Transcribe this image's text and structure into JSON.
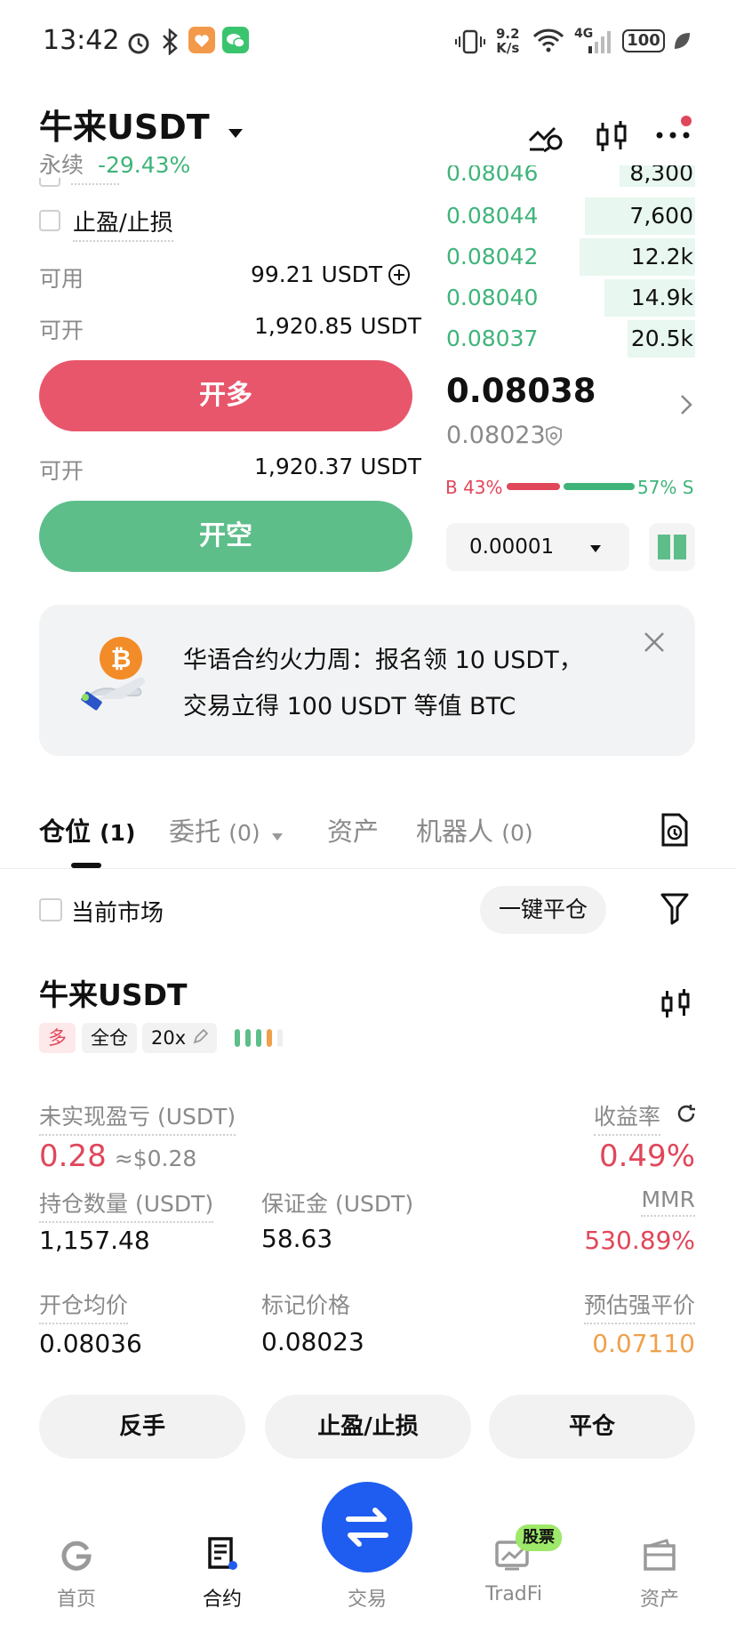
{
  "status_bar": {
    "time": "13:42",
    "net_speed_top": "9.2",
    "net_speed_bottom": "K/s",
    "network": "4G",
    "battery": "100"
  },
  "header": {
    "pair": "牛来USDT",
    "type": "永续",
    "change": "-29.43%"
  },
  "order_form": {
    "tpsl_label": "止盈/止损",
    "available_label": "可用",
    "available_value": "99.21 USDT",
    "long_open_label": "可开",
    "long_open_value": "1,920.85 USDT",
    "long_button": "开多",
    "short_open_label": "可开",
    "short_open_value": "1,920.37 USDT",
    "short_button": "开空"
  },
  "orderbook": {
    "top_partial_price": "0.08046",
    "top_partial_qty": "8,300",
    "asks": [
      {
        "price": "0.08044",
        "qty": "7,600",
        "depth": 0.44
      },
      {
        "price": "0.08042",
        "qty": "12.2k",
        "depth": 0.46
      },
      {
        "price": "0.08040",
        "qty": "14.9k",
        "depth": 0.36
      },
      {
        "price": "0.08037",
        "qty": "20.5k",
        "depth": 0.27
      }
    ],
    "last_price": "0.08038",
    "mark_price": "0.08023",
    "buy_ratio_label": "B 43%",
    "sell_ratio_label": "57% S",
    "buy_ratio": 0.43,
    "precision": "0.00001"
  },
  "banner": {
    "line1": "华语合约火力周：报名领 10 USDT，",
    "line2": "交易立得 100 USDT 等值 BTC"
  },
  "tabs": [
    {
      "label": "仓位",
      "count": "(1)"
    },
    {
      "label": "委托",
      "count": "(0)"
    },
    {
      "label": "资产",
      "count": ""
    },
    {
      "label": "机器人",
      "count": "(0)"
    }
  ],
  "filter": {
    "current_market": "当前市场",
    "close_all": "一键平仓"
  },
  "position": {
    "pair": "牛来USDT",
    "side": "多",
    "margin_mode": "全仓",
    "leverage": "20x",
    "unrealized_pnl_label": "未实现盈亏 (USDT)",
    "unrealized_pnl": "0.28",
    "unrealized_pnl_usd": "≈$0.28",
    "roe_label": "收益率",
    "roe": "0.49%",
    "size_label": "持仓数量 (USDT)",
    "size": "1,157.48",
    "margin_label": "保证金 (USDT)",
    "margin": "58.63",
    "mmr_label": "MMR",
    "mmr": "530.89%",
    "entry_label": "开仓均价",
    "entry": "0.08036",
    "mark_label": "标记价格",
    "mark": "0.08023",
    "liq_label": "预估强平价",
    "liq": "0.07110",
    "btn_reverse": "反手",
    "btn_tpsl": "止盈/止损",
    "btn_close": "平仓"
  },
  "bottom_nav": [
    {
      "label": "首页",
      "icon": "home-icon"
    },
    {
      "label": "合约",
      "icon": "contract-icon"
    },
    {
      "label": "交易",
      "icon": "swap-icon"
    },
    {
      "label": "TradFi",
      "icon": "tradfi-icon",
      "badge": "股票"
    },
    {
      "label": "资产",
      "icon": "wallet-icon"
    }
  ],
  "colors": {
    "green": "#3fb47a",
    "red": "#e0475a",
    "blue": "#1f5cf0",
    "orange": "#f0a04b"
  }
}
